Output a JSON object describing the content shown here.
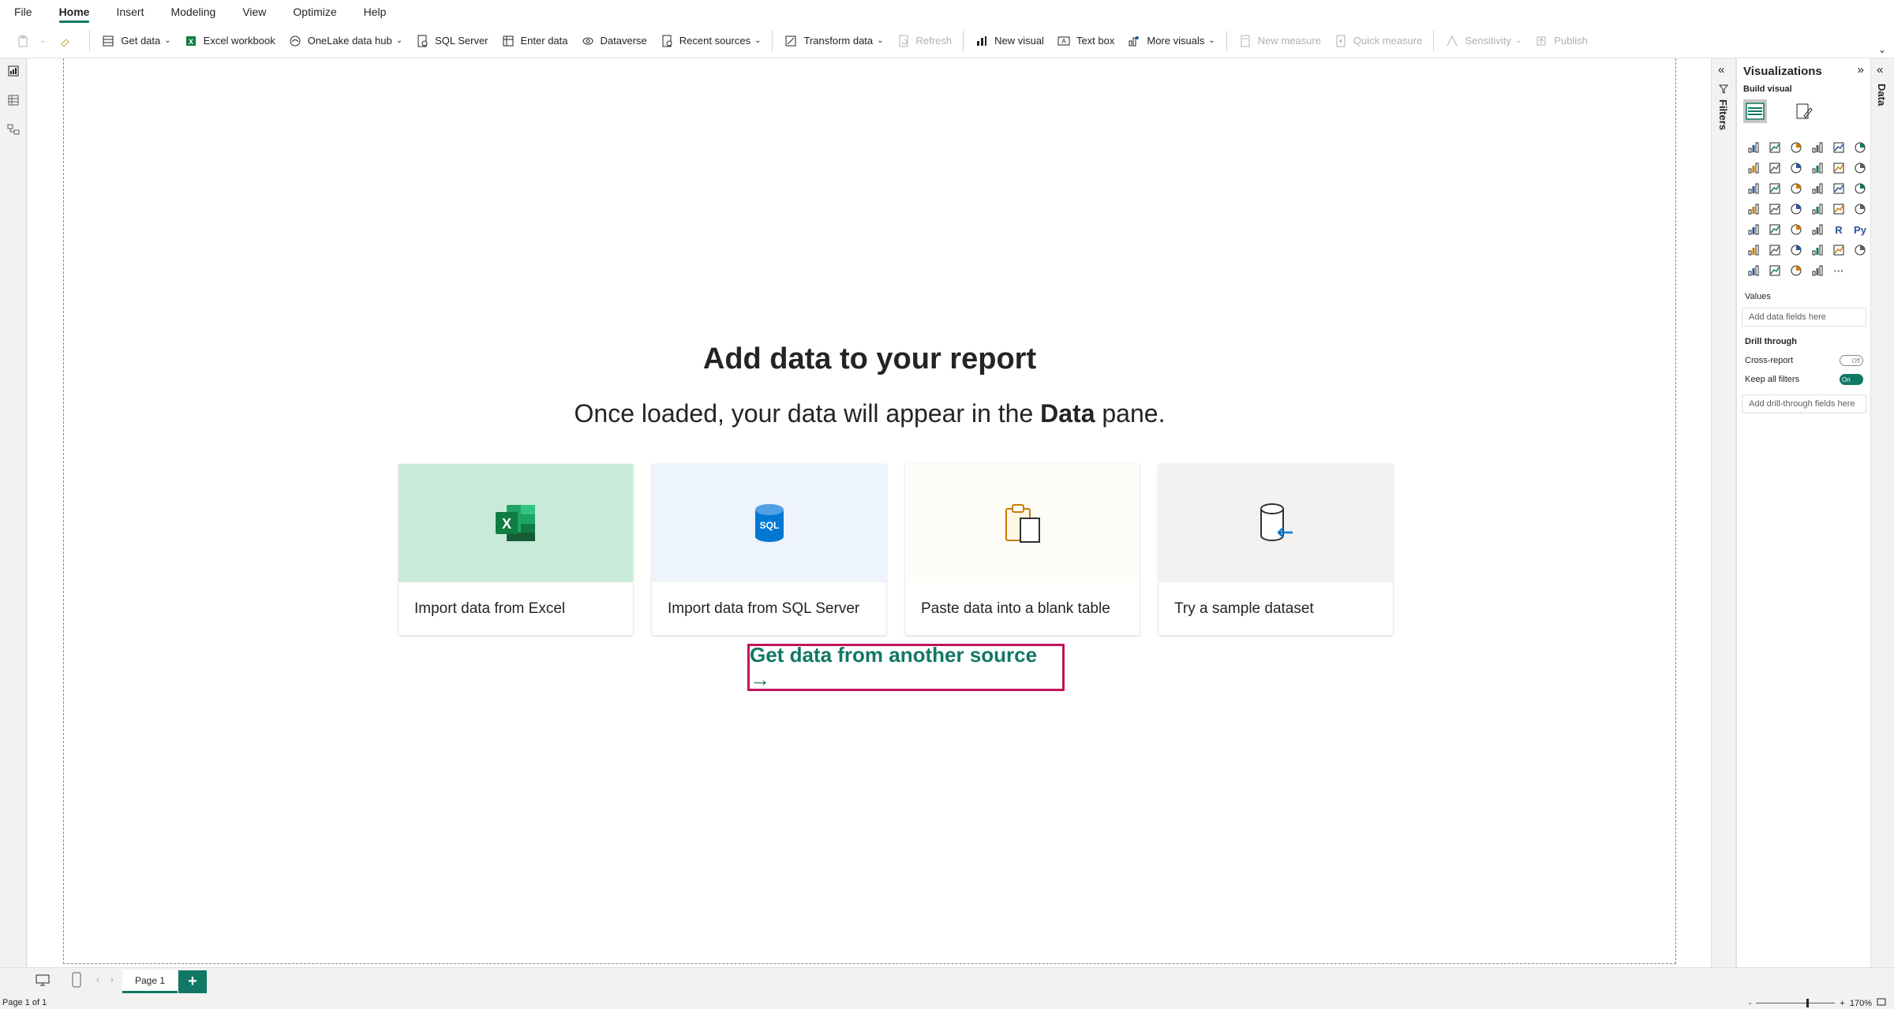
{
  "menu": [
    "File",
    "Home",
    "Insert",
    "Modeling",
    "View",
    "Optimize",
    "Help"
  ],
  "ribbon": {
    "get_data": "Get data",
    "excel_workbook": "Excel workbook",
    "onelake": "OneLake data hub",
    "sql_server": "SQL Server",
    "enter_data": "Enter data",
    "dataverse": "Dataverse",
    "recent_sources": "Recent sources",
    "transform_data": "Transform data",
    "refresh": "Refresh",
    "new_visual": "New visual",
    "text_box": "Text box",
    "more_visuals": "More visuals",
    "new_measure": "New measure",
    "quick_measure": "Quick measure",
    "sensitivity": "Sensitivity",
    "publish": "Publish"
  },
  "canvas": {
    "title": "Add data to your report",
    "subtitle_before": "Once loaded, your data will appear in the",
    "subtitle_bold": "Data",
    "subtitle_after": "pane.",
    "cards": [
      {
        "label": "Import data from Excel",
        "color": "#c9ead9"
      },
      {
        "label": "Import data from SQL Server",
        "color": "#eef4fb"
      },
      {
        "label": "Paste data into a blank table",
        "color": "#fdfcf6"
      },
      {
        "label": "Try a sample dataset",
        "color": "#f3f2f1"
      }
    ],
    "other_source": "Get data from another source →"
  },
  "filters": {
    "label": "Filters"
  },
  "viz": {
    "title": "Visualizations",
    "build_label": "Build visual",
    "values_label": "Values",
    "values_placeholder": "Add data fields here",
    "drill_label": "Drill through",
    "cross_report": "Cross-report",
    "cross_report_state": "Off",
    "keep_filters": "Keep all filters",
    "keep_filters_state": "On",
    "drill_placeholder": "Add drill-through fields here",
    "r_glyph": "R",
    "py_glyph": "Py",
    "more_glyph": "···"
  },
  "data_pane": {
    "label": "Data"
  },
  "pages": {
    "tab": "Page 1",
    "add": "+"
  },
  "status": {
    "page_info": "Page 1 of 1",
    "zoom": "170%"
  },
  "colors": {
    "accent": "#117865",
    "highlight": "#c0155d"
  }
}
